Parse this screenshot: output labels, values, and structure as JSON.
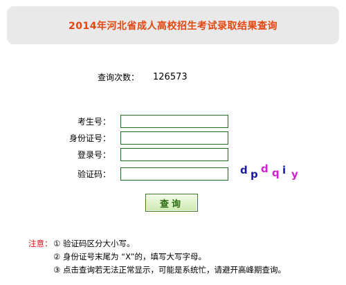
{
  "header": {
    "title": "2014年河北省成人高校招生考试录取结果查询"
  },
  "stats": {
    "count_label": "查询次数：",
    "count_value": "126573"
  },
  "form": {
    "exam_no_label": "考生号：",
    "exam_no_value": "",
    "id_no_label": "身份证号：",
    "id_no_value": "",
    "login_no_label": "登录号：",
    "login_no_value": "",
    "captcha_label": "验证码：",
    "captcha_value": "",
    "captcha_chars": [
      {
        "char": "d",
        "color": "#1a1aa0"
      },
      {
        "char": "p",
        "color": "#1a1aa0"
      },
      {
        "char": "d",
        "color": "#cc22cc"
      },
      {
        "char": "q",
        "color": "#cc22cc"
      },
      {
        "char": "i",
        "color": "#1a1aa0"
      },
      {
        "char": "y",
        "color": "#cc22cc"
      }
    ],
    "submit_label": "查询"
  },
  "notes": {
    "heading": "注意：",
    "items": [
      "① 验证码区分大小写。",
      "② 身份证号末尾为 “X”的，填写大写字母。",
      "③ 点击查询若无法正常显示，可能是系统忙，请避开高峰期查询。"
    ]
  },
  "colors": {
    "title": "#e3470f",
    "note_heading": "#d8181c",
    "input_border": "#1d6b1d"
  }
}
